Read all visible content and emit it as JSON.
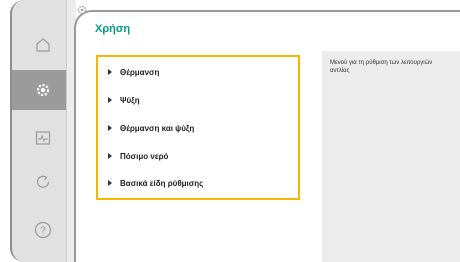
{
  "header": {
    "title": "Χρήση"
  },
  "sidebar": {
    "items": [
      {
        "icon": "home-icon",
        "active": false
      },
      {
        "icon": "gear-icon",
        "active": true
      },
      {
        "icon": "monitor-icon",
        "active": false
      },
      {
        "icon": "undo-icon",
        "active": false
      },
      {
        "icon": "help-icon",
        "active": false
      }
    ]
  },
  "menu": {
    "items": [
      {
        "label": "Θέρμανση"
      },
      {
        "label": "Ψύξη"
      },
      {
        "label": "Θέρμανση και ψύξη"
      },
      {
        "label": "Πόσιμο νερό"
      },
      {
        "label": "Βασικά είδη ρύθμισης"
      }
    ]
  },
  "help": {
    "text": "Μενού για τη ρύθμιση των λειτουργιών αντλίας"
  },
  "colors": {
    "title": "#009c82",
    "focus": "#f5b700",
    "active_rail": "#9b9b9b"
  }
}
